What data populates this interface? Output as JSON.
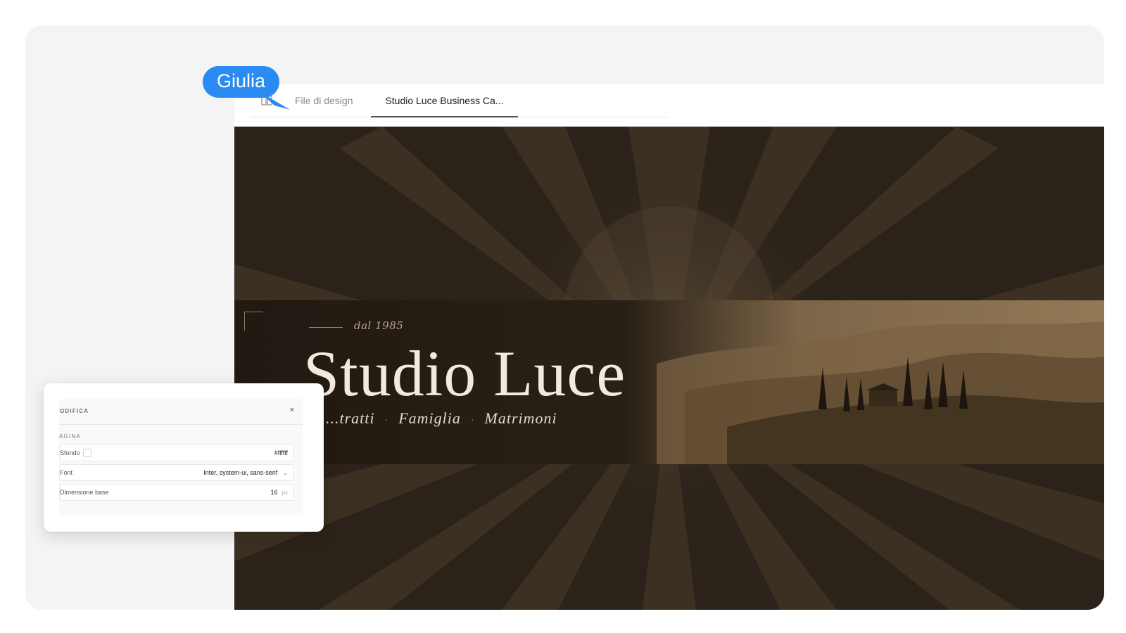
{
  "collaborator": {
    "name": "Giulia",
    "color": "#2b8bf2"
  },
  "tabs": {
    "icon": "book-icon",
    "files_label": "File di design",
    "active_label": "Studio Luce Business Ca..."
  },
  "design": {
    "since": "dal 1985",
    "title": "Studio Luce",
    "services": [
      "...tratti",
      "Famiglia",
      "Matrimoni"
    ],
    "separator": "·",
    "palette": {
      "background": "#2a2219",
      "title": "#f2ebdd",
      "accent": "#9d8a6f"
    }
  },
  "panel": {
    "title": "ODIFICA",
    "close_label": "×",
    "section": "AGINA",
    "fields": {
      "background_label": "Sfondo",
      "background_value": "#ffffff",
      "font_label": "Font",
      "font_value": "Inter, system-ui, sans-serif",
      "size_label": "Dimensione base",
      "size_value": "16",
      "size_unit": "px"
    }
  }
}
